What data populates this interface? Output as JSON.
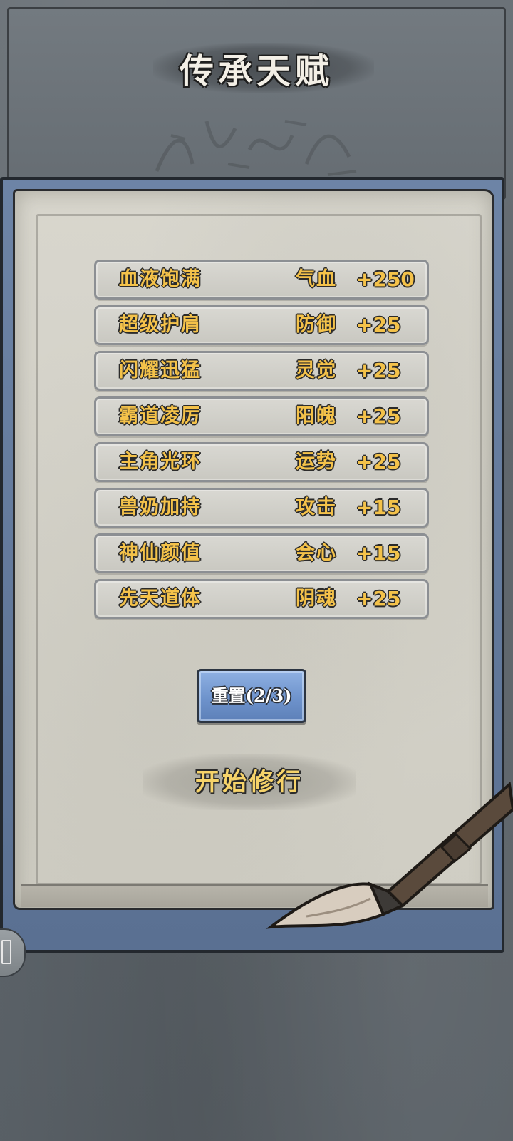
{
  "header": {
    "title": "传承天赋"
  },
  "traits": [
    {
      "name": "血液饱满",
      "stat": "气血",
      "bonus": "+250"
    },
    {
      "name": "超级护肩",
      "stat": "防御",
      "bonus": "+25"
    },
    {
      "name": "闪耀迅猛",
      "stat": "灵觉",
      "bonus": "+25"
    },
    {
      "name": "霸道凌厉",
      "stat": "阳魄",
      "bonus": "+25"
    },
    {
      "name": "主角光环",
      "stat": "运势",
      "bonus": "+25"
    },
    {
      "name": "兽奶加持",
      "stat": "攻击",
      "bonus": "+15"
    },
    {
      "name": "神仙颜值",
      "stat": "会心",
      "bonus": "+15"
    },
    {
      "name": "先天道体",
      "stat": "阴魂",
      "bonus": "+25"
    }
  ],
  "actions": {
    "reset_label": "重置(2/3)",
    "start_label": "开始修行"
  },
  "icons": {
    "brush": "brush-icon",
    "side": "scroll-icon"
  },
  "colors": {
    "accent_gold": "#f4c24a",
    "button_blue": "#6e93cc",
    "paper": "#d8d6cd",
    "book_blue": "#6d84a6"
  }
}
